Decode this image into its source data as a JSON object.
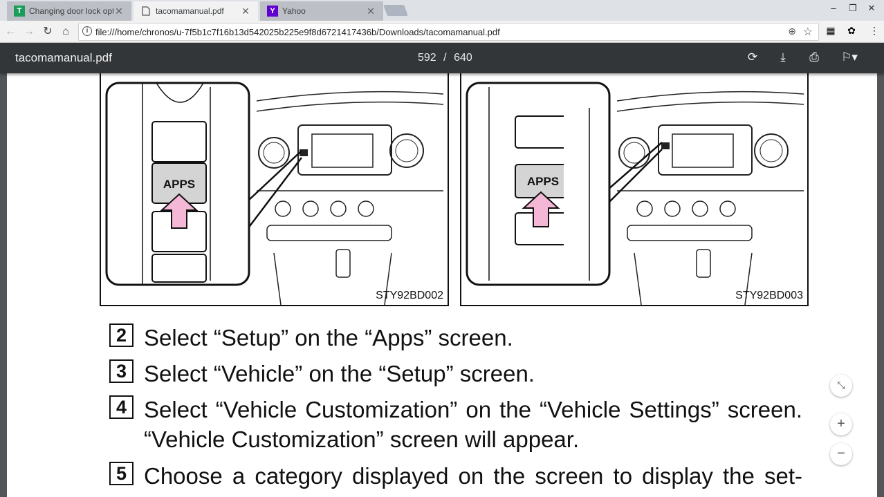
{
  "tabs": [
    {
      "title": "Changing door lock opti",
      "favicon": "T",
      "favicon_color": "#1a9c5b",
      "active": false
    },
    {
      "title": "tacomamanual.pdf",
      "favicon": "doc",
      "active": true
    },
    {
      "title": "Yahoo",
      "favicon": "Y",
      "favicon_color": "#5f01d1",
      "active": false
    }
  ],
  "toolbar": {
    "url": "file:///home/chronos/u-7f5b1c7f16b13d542025b225e9f8d6721417436b/Downloads/tacomamanual.pdf"
  },
  "pdf": {
    "title": "tacomamanual.pdf",
    "page_current": "592",
    "page_sep": "/",
    "page_total": "640"
  },
  "figures": [
    {
      "code": "STY92BD002",
      "button_label": "APPS"
    },
    {
      "code": "STY92BD003",
      "button_label": "APPS"
    }
  ],
  "steps": [
    {
      "num": "2",
      "text": "Select “Setup” on the “Apps” screen."
    },
    {
      "num": "3",
      "text": "Select “Vehicle” on the “Setup” screen."
    },
    {
      "num": "4",
      "text": "Select “Vehicle Customization” on the “Vehicle Settings” screen.",
      "text2": "“Vehicle Customization” screen will appear."
    },
    {
      "num": "5",
      "text": "Choose a category displayed on the screen to display the set-"
    }
  ],
  "colors": {
    "arrow_pink": "#f4b7d6",
    "pdf_toolbar": "#323639"
  }
}
